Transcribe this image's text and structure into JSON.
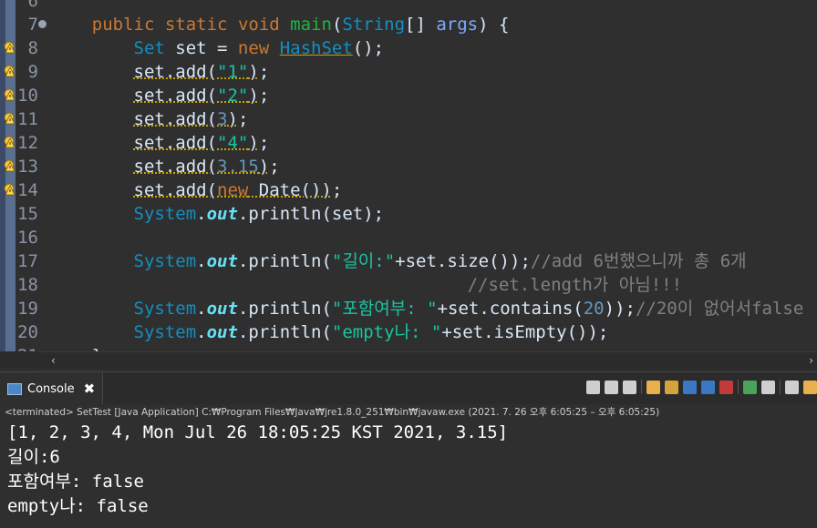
{
  "editor": {
    "lines": [
      {
        "n": "6",
        "warn": false,
        "fold": false,
        "tokens": []
      },
      {
        "n": "7",
        "warn": false,
        "fold": true,
        "tokens": [
          {
            "c": "plain",
            "t": "    "
          },
          {
            "c": "kw",
            "t": "public"
          },
          {
            "c": "plain",
            "t": " "
          },
          {
            "c": "kw",
            "t": "static"
          },
          {
            "c": "plain",
            "t": " "
          },
          {
            "c": "kw",
            "t": "void"
          },
          {
            "c": "plain",
            "t": " "
          },
          {
            "c": "fn",
            "t": "main"
          },
          {
            "c": "plain",
            "t": "("
          },
          {
            "c": "ty",
            "t": "String"
          },
          {
            "c": "plain",
            "t": "[] "
          },
          {
            "c": "prm",
            "t": "args"
          },
          {
            "c": "plain",
            "t": ") {"
          }
        ]
      },
      {
        "n": "8",
        "warn": true,
        "fold": false,
        "tokens": [
          {
            "c": "plain",
            "t": "        "
          },
          {
            "c": "ty",
            "t": "Set"
          },
          {
            "c": "plain",
            "t": " set = "
          },
          {
            "c": "kw",
            "t": "new"
          },
          {
            "c": "plain",
            "t": " "
          },
          {
            "c": "ty ulr",
            "t": "HashSet"
          },
          {
            "c": "plain",
            "t": "();"
          }
        ]
      },
      {
        "n": "9",
        "warn": true,
        "fold": false,
        "tokens": [
          {
            "c": "plain",
            "t": "        "
          },
          {
            "c": "plain ul",
            "t": "set.add("
          },
          {
            "c": "str ul",
            "t": "\"1\""
          },
          {
            "c": "plain ul",
            "t": ")"
          },
          {
            "c": "plain",
            "t": ";"
          }
        ]
      },
      {
        "n": "10",
        "warn": true,
        "fold": false,
        "tokens": [
          {
            "c": "plain",
            "t": "        "
          },
          {
            "c": "plain ul",
            "t": "set.add("
          },
          {
            "c": "str ul",
            "t": "\"2\""
          },
          {
            "c": "plain ul",
            "t": ")"
          },
          {
            "c": "plain",
            "t": ";"
          }
        ]
      },
      {
        "n": "11",
        "warn": true,
        "fold": false,
        "tokens": [
          {
            "c": "plain",
            "t": "        "
          },
          {
            "c": "plain ul",
            "t": "set.add("
          },
          {
            "c": "num ul",
            "t": "3"
          },
          {
            "c": "plain ul",
            "t": ")"
          },
          {
            "c": "plain",
            "t": ";"
          }
        ]
      },
      {
        "n": "12",
        "warn": true,
        "fold": false,
        "tokens": [
          {
            "c": "plain",
            "t": "        "
          },
          {
            "c": "plain ul",
            "t": "set.add("
          },
          {
            "c": "str ul",
            "t": "\"4\""
          },
          {
            "c": "plain ul",
            "t": ")"
          },
          {
            "c": "plain",
            "t": ";"
          }
        ]
      },
      {
        "n": "13",
        "warn": true,
        "fold": false,
        "tokens": [
          {
            "c": "plain",
            "t": "        "
          },
          {
            "c": "plain ul",
            "t": "set.add("
          },
          {
            "c": "num ul",
            "t": "3.15"
          },
          {
            "c": "plain ul",
            "t": ")"
          },
          {
            "c": "plain",
            "t": ";"
          }
        ]
      },
      {
        "n": "14",
        "warn": true,
        "fold": false,
        "tokens": [
          {
            "c": "plain",
            "t": "        "
          },
          {
            "c": "plain ul",
            "t": "set.add("
          },
          {
            "c": "kw ul",
            "t": "new"
          },
          {
            "c": "plain ul",
            "t": " Date())"
          },
          {
            "c": "plain",
            "t": ";"
          }
        ]
      },
      {
        "n": "15",
        "warn": false,
        "fold": false,
        "tokens": [
          {
            "c": "plain",
            "t": "        "
          },
          {
            "c": "ty",
            "t": "System"
          },
          {
            "c": "plain",
            "t": "."
          },
          {
            "c": "fld",
            "t": "out"
          },
          {
            "c": "plain",
            "t": ".println(set);"
          }
        ]
      },
      {
        "n": "16",
        "warn": false,
        "fold": false,
        "tokens": []
      },
      {
        "n": "17",
        "warn": false,
        "fold": false,
        "tokens": [
          {
            "c": "plain",
            "t": "        "
          },
          {
            "c": "ty",
            "t": "System"
          },
          {
            "c": "plain",
            "t": "."
          },
          {
            "c": "fld",
            "t": "out"
          },
          {
            "c": "plain",
            "t": ".println("
          },
          {
            "c": "str",
            "t": "\"길이:\""
          },
          {
            "c": "plain",
            "t": "+set.size());"
          },
          {
            "c": "cm",
            "t": "//add 6번했으니까 총 6개"
          }
        ]
      },
      {
        "n": "18",
        "warn": false,
        "fold": false,
        "tokens": [
          {
            "c": "plain",
            "t": "                                        "
          },
          {
            "c": "cm",
            "t": "//set.length가 아님!!!"
          }
        ]
      },
      {
        "n": "19",
        "warn": false,
        "fold": false,
        "tokens": [
          {
            "c": "plain",
            "t": "        "
          },
          {
            "c": "ty",
            "t": "System"
          },
          {
            "c": "plain",
            "t": "."
          },
          {
            "c": "fld",
            "t": "out"
          },
          {
            "c": "plain",
            "t": ".println("
          },
          {
            "c": "str",
            "t": "\"포함여부: \""
          },
          {
            "c": "plain",
            "t": "+set.contains("
          },
          {
            "c": "num",
            "t": "20"
          },
          {
            "c": "plain",
            "t": "));"
          },
          {
            "c": "cm",
            "t": "//20이 없어서false"
          }
        ]
      },
      {
        "n": "20",
        "warn": false,
        "fold": false,
        "tokens": [
          {
            "c": "plain",
            "t": "        "
          },
          {
            "c": "ty",
            "t": "System"
          },
          {
            "c": "plain",
            "t": "."
          },
          {
            "c": "fld",
            "t": "out"
          },
          {
            "c": "plain",
            "t": ".println("
          },
          {
            "c": "str",
            "t": "\"empty나: \""
          },
          {
            "c": "plain",
            "t": "+set.isEmpty());"
          }
        ]
      },
      {
        "n": "21",
        "warn": false,
        "fold": false,
        "tokens": [
          {
            "c": "plain",
            "t": "    }"
          }
        ]
      }
    ]
  },
  "scrollbar": {
    "left_arrow": "‹",
    "right_arrow": "›"
  },
  "console": {
    "tab_label": "Console",
    "close_glyph": "✖",
    "status": "<terminated> SetTest [Java Application] C:₩Program Files₩Java₩jre1.8.0_251₩bin₩javaw.exe  (2021. 7. 26 오후 6:05:25 – 오후 6:05:25)",
    "output": [
      "[1, 2, 3, 4, Mon Jul 26 18:05:25 KST 2021, 3.15]",
      "길이:6",
      "포함여부: false",
      "empty나: false"
    ],
    "toolbar_colors": [
      "#cfcfcf",
      "#cfcfcf",
      "#cfcfcf",
      "#e8b04a",
      "#d6a23c",
      "#3b78c4",
      "#3b78c4",
      "#c23b3b",
      "#4aa35a",
      "#cfcfcf",
      "#cfcfcf",
      "#e8b04a"
    ]
  }
}
